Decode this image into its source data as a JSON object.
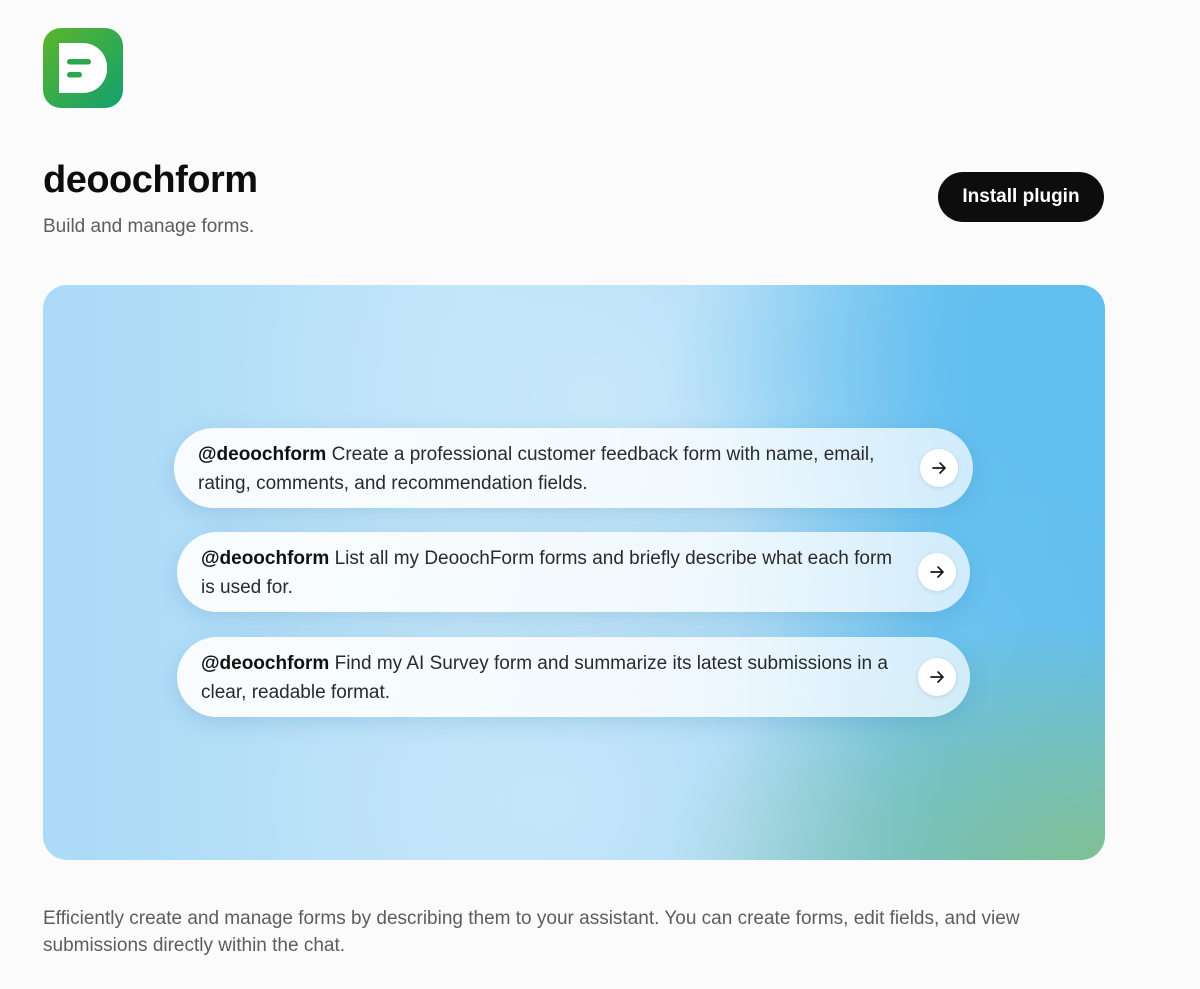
{
  "plugin": {
    "name": "deoochform",
    "tagline": "Build and manage forms.",
    "logo_icon": "deoochform-logo-icon"
  },
  "header": {
    "install_label": "Install plugin"
  },
  "prompts": [
    {
      "mention": "@deoochform",
      "text": " Create a professional customer feedback form with name, email, rating, comments, and recommendation fields.",
      "action_icon": "arrow-right-icon"
    },
    {
      "mention": "@deoochform",
      "text": " List all my DeoochForm forms and briefly describe what each form is used for.",
      "action_icon": "arrow-right-icon"
    },
    {
      "mention": "@deoochform",
      "text": " Find my AI Survey form and summarize its latest submissions in a clear, readable format.",
      "action_icon": "arrow-right-icon"
    }
  ],
  "description": "Efficiently create and manage forms by describing them to your assistant. You can create forms, edit fields, and view submissions directly within the chat.",
  "colors": {
    "logo_gradient_start": "#57b22e",
    "logo_gradient_end": "#13a06d",
    "button_background": "#0d0d0d",
    "hero_blue": "#64bfed",
    "hero_green": "#80c094"
  }
}
